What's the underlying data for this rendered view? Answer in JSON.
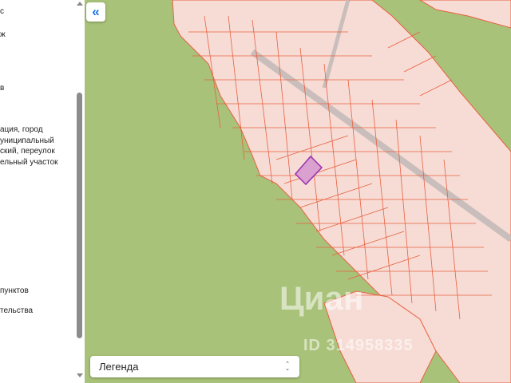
{
  "sidebar": {
    "lines": [
      "с",
      "ж",
      "в",
      "ация, город",
      "униципальный",
      "ский, переулок",
      "ельный участок",
      "пунктов",
      "тельства"
    ]
  },
  "map": {
    "collapse_icon": "«",
    "legend_label": "Легенда",
    "legend_arrows_up": "⌃",
    "legend_arrows_down": "⌄",
    "watermark_brand": "Циан",
    "watermark_id": "ID 314958335",
    "colors": {
      "forest": "#a9c279",
      "plot_fill": "#f7dcd6",
      "plot_border": "#e8603f",
      "selected_fill": "#d9a0d0",
      "selected_border": "#9b2fae",
      "road": "#b7b7b7"
    }
  }
}
